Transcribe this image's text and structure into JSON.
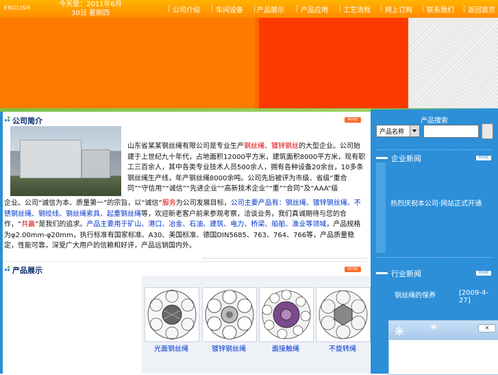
{
  "header": {
    "english_label": "ENGLISH",
    "date_text": "今天是：2011年6月30日 星期四",
    "nav_items": [
      {
        "label": "公司介绍"
      },
      {
        "label": "车间设备"
      },
      {
        "label": "产品展示"
      },
      {
        "label": "产品应用"
      },
      {
        "label": "工艺流程"
      },
      {
        "label": "网上订购"
      },
      {
        "label": "联系我们"
      },
      {
        "label": "返回首页"
      }
    ]
  },
  "about": {
    "title": "公司简介",
    "more_label": "MORE",
    "para1_a": "山东省某某钢丝绳有限公司是专业生产",
    "para1_red": "钢丝绳、镀锌钢丝",
    "para1_b": "的大型企业。公司始建于上世纪九十年代，占地面积12000平方米，建筑面积8000平方米，现有职工三百余人，其中各类专业技术人员500余人，拥有各种设备20余台，10多条钢丝绳生产线，年产钢丝绳8000余吨。公司先后被评为市级、省级“重合同”“守信用”“诚信”“先进企业”“高新技术企业”“重”“合同”及“AAA”级",
    "para2_a": "企业。公司“诚信为本、质量第一”的宗旨，以“诚信”",
    "para2_red": "服务",
    "para2_b": "为公司发展目标，",
    "para2_blue": "公司主要产品有：钢丝绳、镀锌钢丝绳、不锈钢丝绳、钢绞线、钢丝绳索具、起重钢丝绳",
    "para2_c": "等，欢迎新老客户前来参观考察，洽谈业务，我们真诚期待与您的合作，“",
    "para2_red2": "共赢",
    "para2_d": "”是我们的追求。",
    "para2_blue2": "产品主要用于矿山、港口、冶金、石油、建筑、电力、桥梁、船舶、渔业等领域",
    "para2_e": "，产品规格为φ2.00mm-φ20mm，执行标准有国家标准、A30、美国标准、德国DIN5685、763、764、766等，产品质量稳定，性能可靠，深受广大用户的信赖和好评，产品远销国内外。"
  },
  "products": {
    "title": "产品展示",
    "more_label": "MORE",
    "items": [
      {
        "label": "光面钢丝绳"
      },
      {
        "label": "镀锌钢丝绳"
      },
      {
        "label": "面接触绳"
      },
      {
        "label": "不旋转绳"
      }
    ]
  },
  "sidebar": {
    "search_title": "产品搜索",
    "search_select_value": "产品名称",
    "search_input_value": "",
    "news_title": "企业新闻",
    "news_more": "MORE",
    "news_items": [
      {
        "text": "热烈庆祝本公司·网站正式开通"
      }
    ],
    "industry_title": "行业新闻",
    "industry_more": "MORE",
    "industry_items": [
      {
        "text": "钢丝绳的保养",
        "date": "[2009-4-27]"
      }
    ],
    "popup_close": "✕"
  },
  "colors": {
    "nav_bg": "#ff9a00",
    "banner_orange": "#ff7a00",
    "banner_red": "#ff3a00",
    "sidebar_blue": "#2c8fd8",
    "accent_green": "#7ac142"
  }
}
